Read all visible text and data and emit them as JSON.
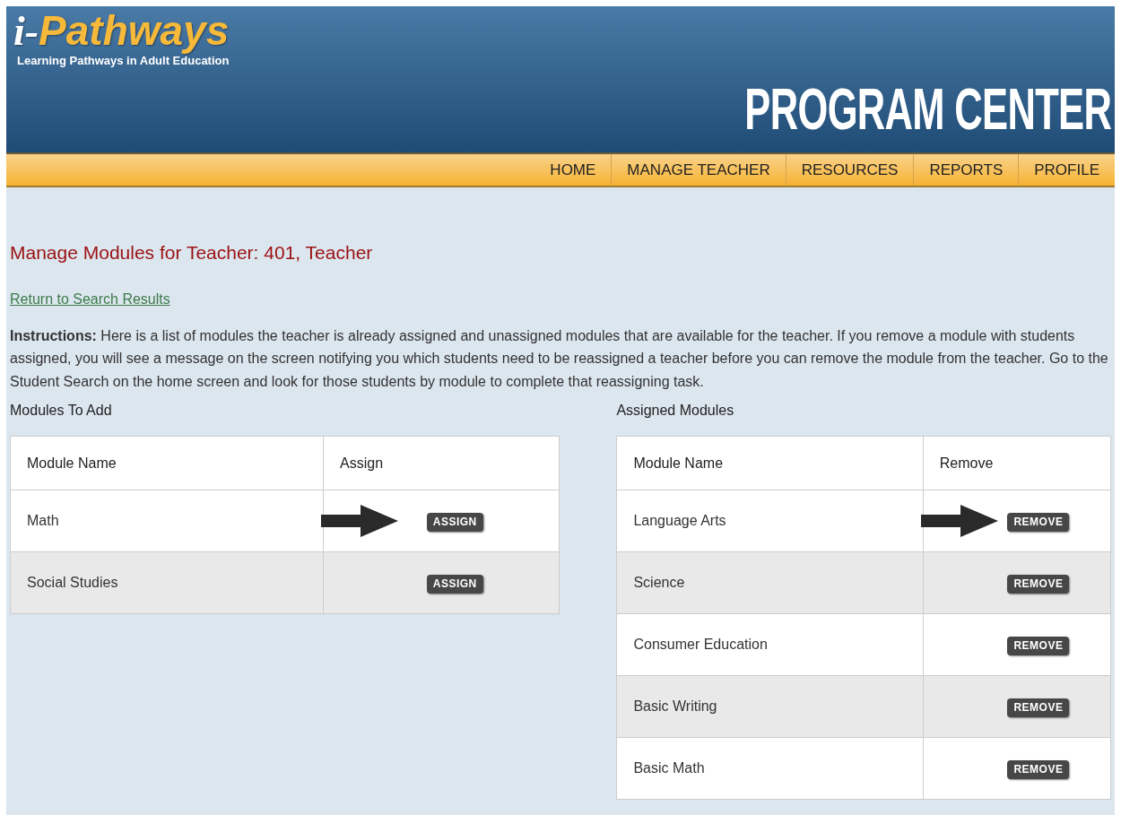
{
  "header": {
    "logo": "i-Pathways",
    "tagline": "Learning Pathways in Adult Education",
    "title": "PROGRAM CENTER"
  },
  "nav": [
    {
      "label": "HOME"
    },
    {
      "label": "MANAGE TEACHER"
    },
    {
      "label": "RESOURCES"
    },
    {
      "label": "REPORTS"
    },
    {
      "label": "PROFILE"
    }
  ],
  "page_title": "Manage Modules for Teacher: 401, Teacher",
  "return_link": "Return to Search Results",
  "instructions": "**Instructions:** Here is a list of modules the teacher is already assigned and unassigned modules that are available for the teacher. If you remove a module with students assigned, you will see a message on the screen notifying you which students need to be reassigned a teacher before you can remove the module from the teacher. Go to the Student Search on the home screen and look for those students by module to complete that reassigning task.",
  "tables": [
    {
      "title": "Modules To Add",
      "columns": [
        "Module Name",
        "Assign"
      ],
      "rows": [
        {
          "name": "Math",
          "button": "ASSIGN",
          "arrow": true
        },
        {
          "name": "Social Studies",
          "button": "ASSIGN",
          "arrow": false
        }
      ]
    },
    {
      "title": "Assigned Modules",
      "columns": [
        "Module Name",
        "Remove"
      ],
      "rows": [
        {
          "name": "Language Arts",
          "button": "REMOVE",
          "arrow": true
        },
        {
          "name": "Science",
          "button": "REMOVE",
          "arrow": false
        },
        {
          "name": "Consumer Education",
          "button": "REMOVE",
          "arrow": false
        },
        {
          "name": "Basic Writing",
          "button": "REMOVE",
          "arrow": false
        },
        {
          "name": "Basic Math",
          "button": "REMOVE",
          "arrow": false
        }
      ]
    }
  ]
}
